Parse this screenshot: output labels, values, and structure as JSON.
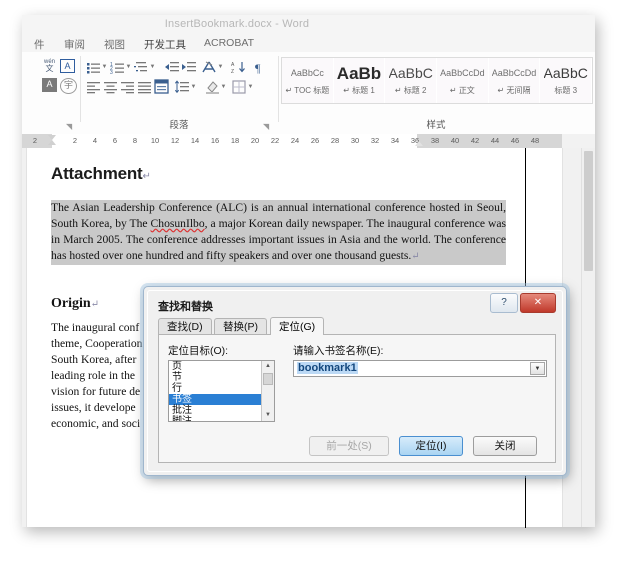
{
  "window": {
    "title": "InsertBookmark.docx - Word"
  },
  "ribbon": {
    "tabs": [
      {
        "label": "件",
        "active": false
      },
      {
        "label": "审阅",
        "active": false
      },
      {
        "label": "视图",
        "active": false
      },
      {
        "label": "开发工具",
        "active": true
      },
      {
        "label": "ACROBAT",
        "active": false
      }
    ],
    "groups": [
      {
        "label": "段落"
      },
      {
        "label": "样式"
      }
    ],
    "cjk_buttons": [
      {
        "label": "wén\n文",
        "name": "phonetic-guide-icon"
      },
      {
        "label": "A",
        "name": "character-border-icon"
      },
      {
        "label": "A",
        "name": "text-highlight-icon"
      },
      {
        "label": "宇",
        "name": "enclose-characters-icon"
      }
    ],
    "styles": [
      {
        "preview": "AaBbCc",
        "name": "TOC 标题",
        "mark": "↵"
      },
      {
        "preview": "AaBb",
        "name": "标题 1",
        "mark": "↵"
      },
      {
        "preview": "AaBbC",
        "name": "标题 2",
        "mark": "↵"
      },
      {
        "preview": "AaBbCcDd",
        "name": "正文",
        "mark": "↵"
      },
      {
        "preview": "AaBbCcDd",
        "name": "无间隔",
        "mark": "↵"
      },
      {
        "preview": "AaBbC",
        "name": "标题 3",
        "mark": ""
      }
    ]
  },
  "ruler": {
    "left_number": "2",
    "numbers": [
      "2",
      "4",
      "6",
      "8",
      "10",
      "12",
      "14",
      "16",
      "18",
      "20",
      "22",
      "24",
      "26",
      "28",
      "30",
      "32",
      "34",
      "36",
      "38",
      "40",
      "42",
      "44",
      "46",
      "48"
    ]
  },
  "document": {
    "heading1": "Attachment",
    "heading1_mark": "↵",
    "paragraph1_part_a": "The Asian Leadership Conference (ALC) is an annual international conference hosted in Seoul, South Korea, by The ",
    "paragraph1_misspelled": "ChosunIlbo",
    "paragraph1_part_b": ", a major Korean daily newspaper. The inaugural conference was in March 2005. The conference addresses important issues in Asia and the world. The conference has hosted over one hundred and fifty speakers and over one thousand guests.",
    "paragraph1_mark": "↵",
    "heading2": "Origin",
    "heading2_mark": "↵",
    "paragraph2_lines": [
      "The inaugural conf",
      "theme, Cooperation",
      "South Korea, after",
      "leading role in the",
      "vision for future de",
      "issues, it develope",
      "economic, and soci"
    ]
  },
  "dialog": {
    "title": "查找和替换",
    "help_label": "?",
    "close_label": "✕",
    "tabs": [
      {
        "label": "查找(D)",
        "active": false
      },
      {
        "label": "替换(P)",
        "active": false
      },
      {
        "label": "定位(G)",
        "active": true
      }
    ],
    "target_label": "定位目标(O):",
    "target_items": [
      {
        "label": "页",
        "selected": false
      },
      {
        "label": "节",
        "selected": false
      },
      {
        "label": "行",
        "selected": false
      },
      {
        "label": "书签",
        "selected": true
      },
      {
        "label": "批注",
        "selected": false
      },
      {
        "label": "脚注",
        "selected": false
      }
    ],
    "input_label": "请输入书签名称(E):",
    "input_value": "bookmark1",
    "dropdown_glyph": "▼",
    "buttons": [
      {
        "label": "前一处(S)",
        "state": "disabled"
      },
      {
        "label": "定位(I)",
        "state": "default"
      },
      {
        "label": "关闭",
        "state": "normal"
      }
    ]
  },
  "colors": {
    "selection_blue": "#2a7fd4",
    "text_selection_gray": "#c9c9c9",
    "close_red": "#c0392b",
    "default_button_blue": "#a9d4f2"
  }
}
